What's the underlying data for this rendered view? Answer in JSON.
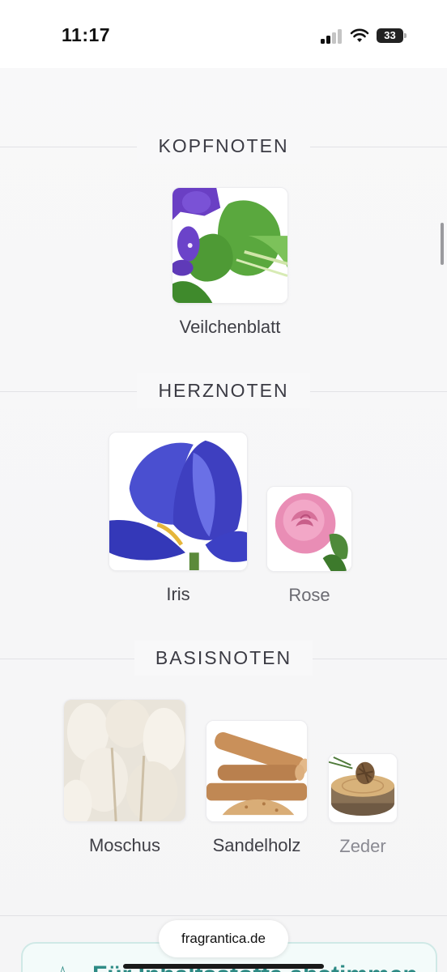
{
  "status_bar": {
    "time": "11:17",
    "battery": "33",
    "signal_icon": "cellular-signal-icon",
    "wifi_icon": "wifi-icon",
    "battery_icon": "battery-icon"
  },
  "sections": {
    "top": {
      "title": "KOPFNOTEN",
      "notes": [
        {
          "label": "Veilchenblatt",
          "icon": "violet-leaf-image"
        }
      ]
    },
    "heart": {
      "title": "HERZNOTEN",
      "notes": [
        {
          "label": "Iris",
          "icon": "iris-image"
        },
        {
          "label": "Rose",
          "icon": "rose-image"
        }
      ]
    },
    "base": {
      "title": "BASISNOTEN",
      "notes": [
        {
          "label": "Moschus",
          "icon": "musk-image"
        },
        {
          "label": "Sandelholz",
          "icon": "sandalwood-image"
        },
        {
          "label": "Zeder",
          "icon": "cedar-image"
        }
      ]
    }
  },
  "bottom": {
    "card_title": "Für Inhaltsstoffe abstimmen",
    "star_icon": "star-icon",
    "url": "fragrantica.de"
  },
  "colors": {
    "accent": "#2c8a84",
    "background": "#f7f7f8"
  }
}
